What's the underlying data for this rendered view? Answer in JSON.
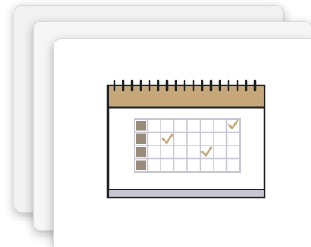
{
  "stack": {
    "card_count": 3
  },
  "calendar_icon": {
    "icon": "calendar-icon",
    "accent_color": "#c6a779",
    "outline_color": "#1f1f1f",
    "grid_color": "#c8c8d4",
    "cell_fill_color": "#ffffff",
    "marker_color": "#c6a779",
    "row_markers": 4,
    "checked_day_count": 3
  }
}
